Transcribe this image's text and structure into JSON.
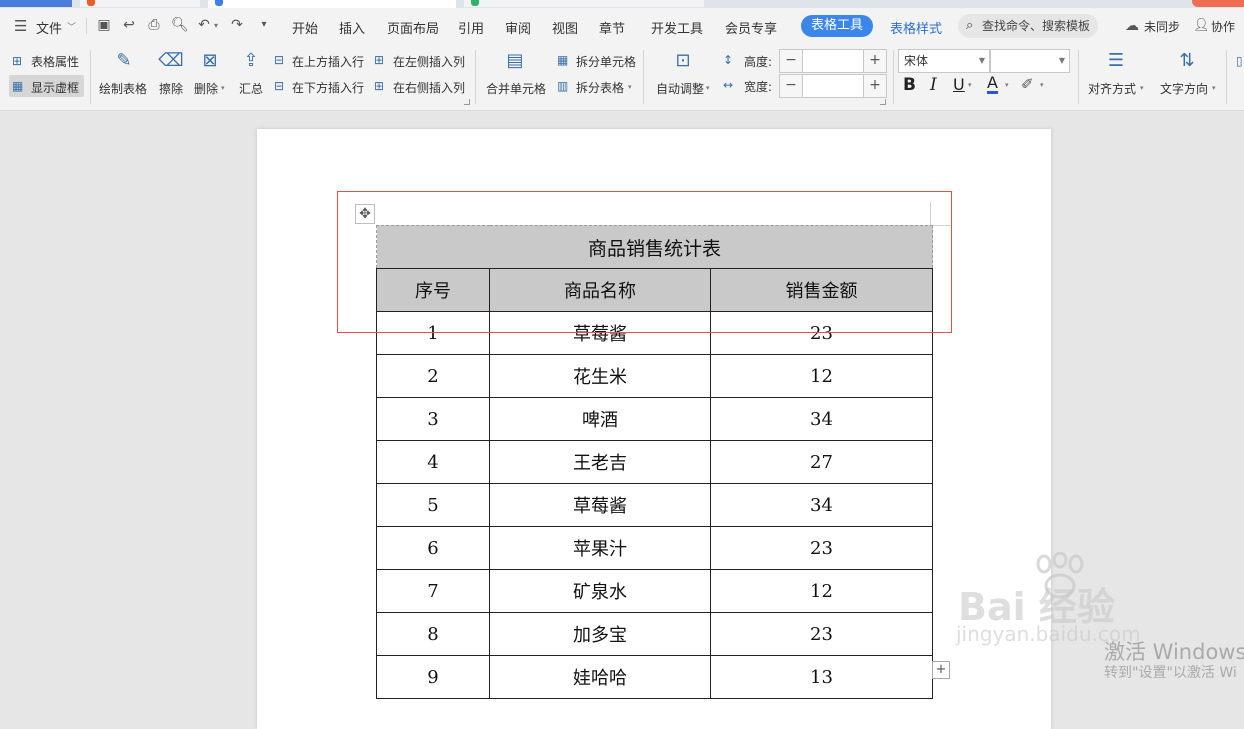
{
  "menubar": {
    "file_label": "文件",
    "items": [
      "开始",
      "插入",
      "页面布局",
      "引用",
      "审阅",
      "视图",
      "章节",
      "开发工具",
      "会员专享"
    ],
    "active_tab": "表格工具",
    "extra_tab": "表格样式",
    "search_placeholder": "查找命令、搜索模板",
    "sync_label": "未同步",
    "collab_label": "协作"
  },
  "ribbon": {
    "table_props": "表格属性",
    "show_gridlines": "显示虚框",
    "draw_table": "绘制表格",
    "erase": "擦除",
    "delete": "删除",
    "summary": "汇总",
    "insert_row_above": "在上方插入行",
    "insert_row_below": "在下方插入行",
    "insert_col_left": "在左侧插入列",
    "insert_col_right": "在右侧插入列",
    "merge_cells": "合并单元格",
    "split_cells": "拆分单元格",
    "split_table": "拆分表格",
    "auto_fit": "自动调整",
    "height_label": "高度:",
    "width_label": "宽度:",
    "font_name": "宋体",
    "font_size": "",
    "bold": "B",
    "italic": "I",
    "underline": "U",
    "font_color": "A",
    "align": "对齐方式",
    "text_direction": "文字方向"
  },
  "document": {
    "table_title": "商品销售统计表",
    "headers": [
      "序号",
      "商品名称",
      "销售金额"
    ],
    "rows": [
      [
        "1",
        "草莓酱",
        "23"
      ],
      [
        "2",
        "花生米",
        "12"
      ],
      [
        "3",
        "啤酒",
        "34"
      ],
      [
        "4",
        "王老吉",
        "27"
      ],
      [
        "5",
        "草莓酱",
        "34"
      ],
      [
        "6",
        "苹果汁",
        "23"
      ],
      [
        "7",
        "矿泉水",
        "12"
      ],
      [
        "8",
        "加多宝",
        "23"
      ],
      [
        "9",
        "娃哈哈",
        "13"
      ]
    ]
  },
  "watermark": {
    "baidu": "Bai 经验",
    "site": "jingyan.baidu.com",
    "windows_line1": "激活 Windows",
    "windows_line2": "转到\"设置\"以激活 Wi"
  },
  "colors": {
    "accent": "#3b86e8",
    "selection": "#e3504f",
    "header_bg": "#c9c9c9"
  }
}
